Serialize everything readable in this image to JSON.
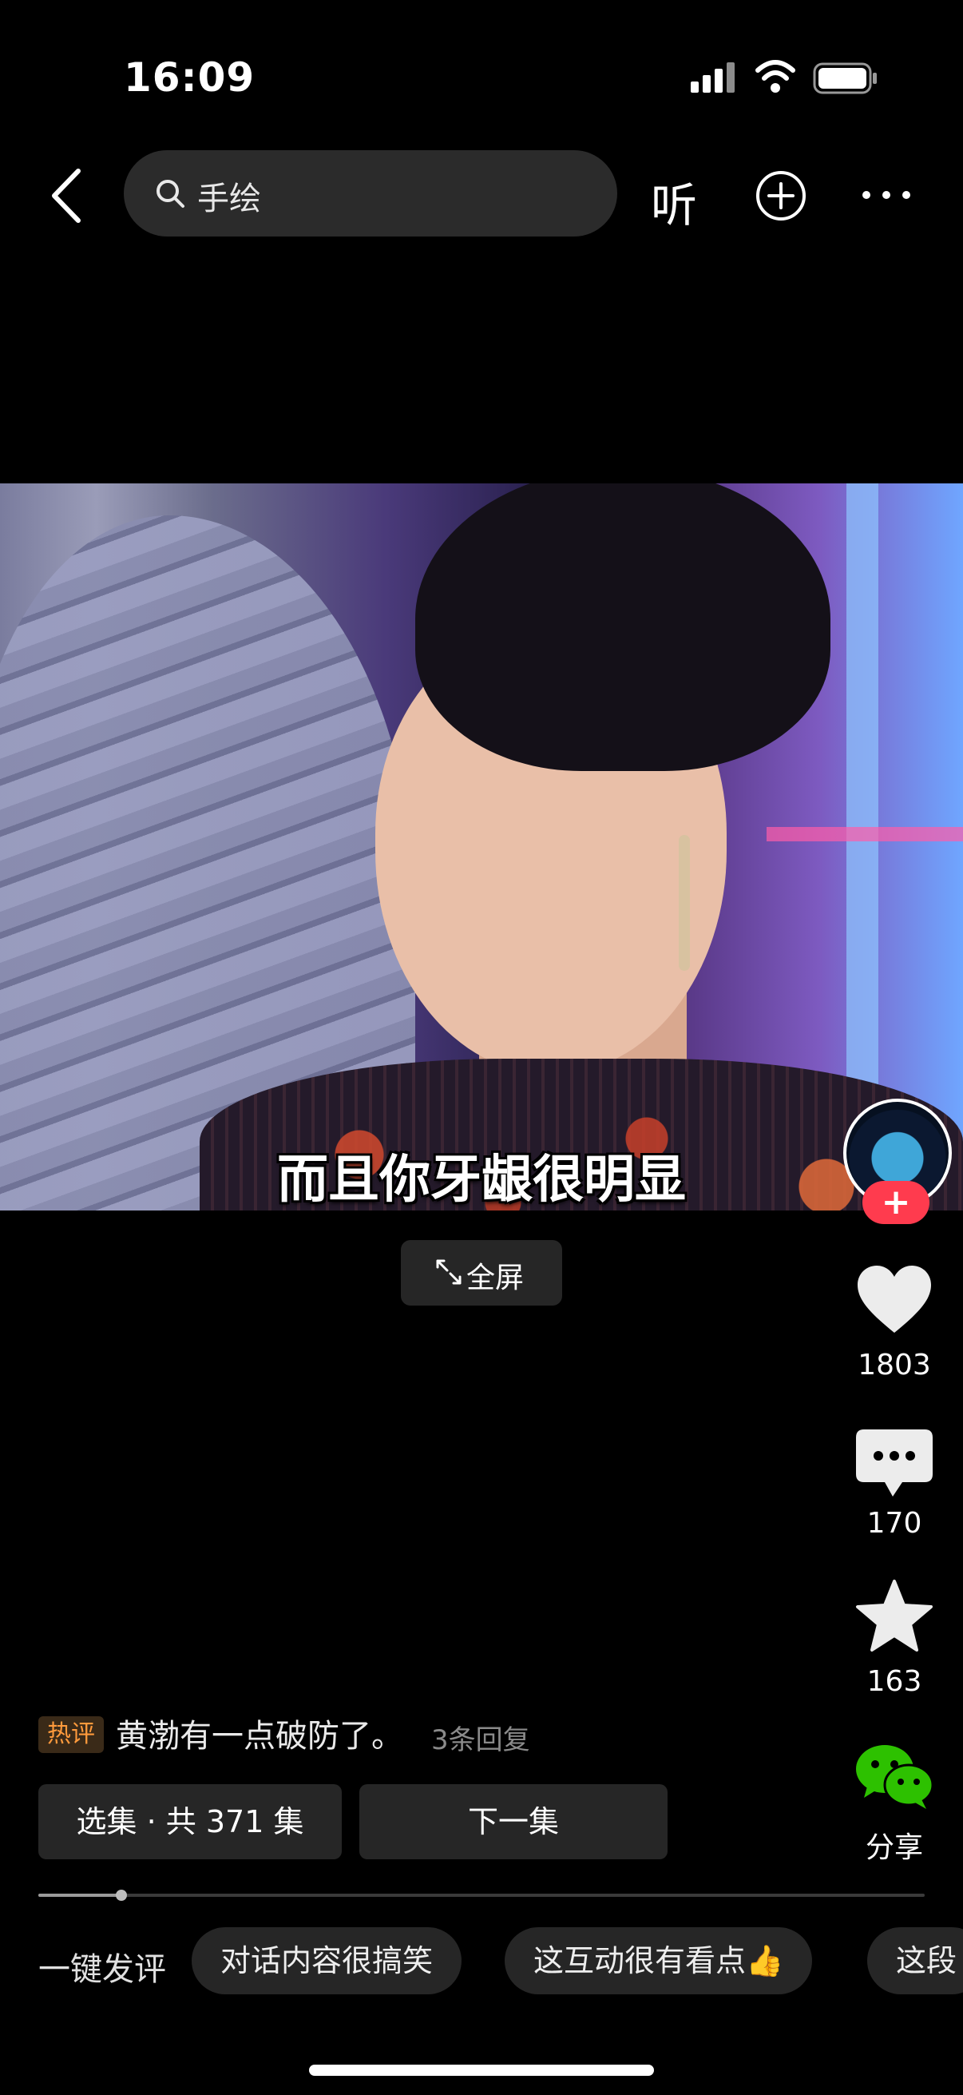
{
  "status_bar": {
    "time": "16:09"
  },
  "top_bar": {
    "search_text": "手绘",
    "listen_label": "听",
    "icons": [
      "back-arrow-icon",
      "search-icon",
      "plus-circle-icon",
      "more-icon"
    ]
  },
  "video": {
    "subtitle": "而且你牙龈很明显"
  },
  "fullscreen_label": "全屏",
  "side_actions": {
    "likes": "1803",
    "comments": "170",
    "favorites": "163",
    "share_label": "分享"
  },
  "hot_comment": {
    "tag": "热评",
    "text": "黄渤有一点破防了。",
    "replies": "3条回复"
  },
  "episodes": {
    "select_label": "选集 · 共 371 集",
    "next_label": "下一集"
  },
  "progress": {
    "fraction": 0.094
  },
  "quick_comments": {
    "label": "一键发评",
    "chips": [
      "对话内容很搞笑",
      "这互动很有看点👍",
      "这段"
    ]
  },
  "colors": {
    "background": "#000000",
    "accent_red": "#ff3b4e",
    "hot_tag": "#ff9a3c",
    "wechat_green": "#2dc100"
  }
}
